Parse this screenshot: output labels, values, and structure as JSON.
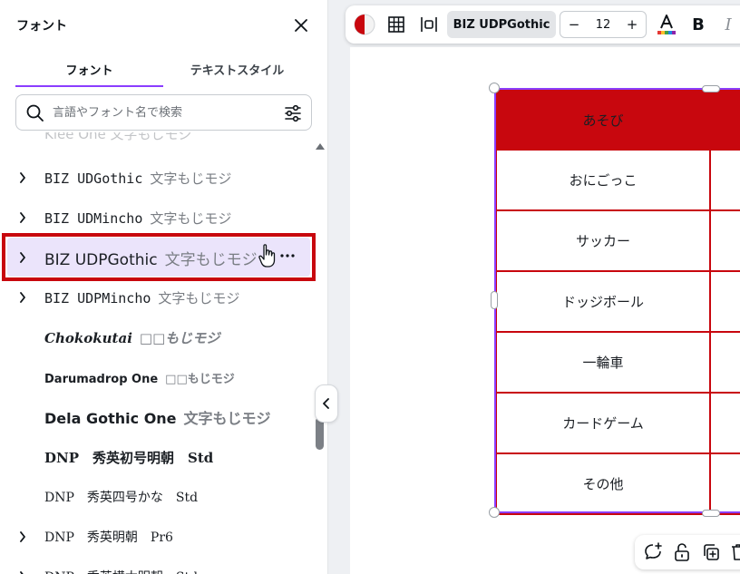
{
  "panel": {
    "title": "フォント",
    "tabs": [
      {
        "label": "フォント",
        "active": true
      },
      {
        "label": "テキストスタイル",
        "active": false
      }
    ],
    "search_placeholder": "言語やフォント名で検索",
    "partial_row_label": "Klee One 文字もじモジ",
    "fonts": [
      {
        "name": "BIZ UDGothic",
        "sample": "文字もじモジ",
        "expandable": true
      },
      {
        "name": "BIZ UDMincho",
        "sample": "文字もじモジ",
        "expandable": true
      },
      {
        "name": "BIZ UDPGothic",
        "sample": "文字もじモジ",
        "expandable": true,
        "selected": true
      },
      {
        "name": "BIZ UDPMincho",
        "sample": "文字もじモジ",
        "expandable": true
      },
      {
        "name": "Chokokutai",
        "sample": "□□もじモジ",
        "expandable": false
      },
      {
        "name": "Darumadrop One",
        "sample": "□□もじモジ",
        "expandable": false
      },
      {
        "name": "Dela Gothic One",
        "sample": "文字もじモジ",
        "expandable": false
      },
      {
        "name": "DNP　秀英初号明朝　Std",
        "sample": "",
        "expandable": false
      },
      {
        "name": "DNP　秀英四号かな　Std",
        "sample": "",
        "expandable": false
      },
      {
        "name": "DNP　秀英明朝　Pr6",
        "sample": "",
        "expandable": true
      },
      {
        "name": "DNP　秀英横太明朝　Std",
        "sample": "",
        "expandable": true
      }
    ]
  },
  "toolbar": {
    "font_name": "BIZ UDPGothic",
    "font_size": "12",
    "minus_label": "−",
    "plus_label": "+",
    "bold_label": "B",
    "italic_label": "I",
    "accent_color": "#c8070e"
  },
  "table": {
    "header_color": "#c8070e",
    "border_color": "#c8070e",
    "header": "あそび",
    "rows": [
      "おにごっこ",
      "サッカー",
      "ドッジボール",
      "一輪車",
      "カードゲーム",
      "その他"
    ]
  },
  "colors": {
    "selection": "#8b3dff",
    "highlight_frame": "#c8070e",
    "selected_row_bg": "#ebe4fb"
  }
}
